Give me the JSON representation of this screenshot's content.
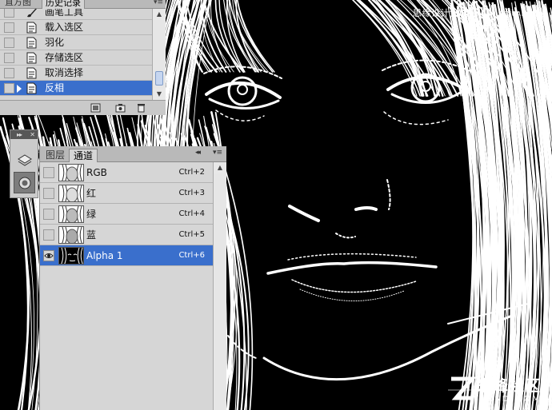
{
  "watermarks": {
    "top_text": "思缘设计论坛",
    "top_url": "www.MISSYUAN.COM",
    "bottom_main": "朱峰社区",
    "bottom_sub": "ZFSD.COM"
  },
  "history_panel": {
    "tabs": [
      {
        "label": "直方图",
        "active": false
      },
      {
        "label": "历史记录",
        "active": true
      }
    ],
    "items": [
      {
        "label": "画笔工具",
        "icon": "brush-icon",
        "selected": false
      },
      {
        "label": "载入选区",
        "icon": "history-state-icon",
        "selected": false
      },
      {
        "label": "羽化",
        "icon": "history-state-icon",
        "selected": false
      },
      {
        "label": "存储选区",
        "icon": "history-state-icon",
        "selected": false
      },
      {
        "label": "取消选择",
        "icon": "history-state-icon",
        "selected": false
      },
      {
        "label": "反相",
        "icon": "history-state-icon",
        "selected": true
      }
    ],
    "bottom_icons": [
      "new-document-from-state-icon",
      "new-snapshot-icon",
      "trash-icon"
    ]
  },
  "toolstrip": {
    "buttons": [
      {
        "icon": "layers-icon",
        "active": false
      },
      {
        "icon": "channels-icon",
        "active": true
      }
    ]
  },
  "channels_panel": {
    "tabs": [
      {
        "label": "图层",
        "active": false
      },
      {
        "label": "通道",
        "active": true
      }
    ],
    "channels": [
      {
        "name": "RGB",
        "shortcut": "Ctrl+2",
        "visible": false,
        "selected": false
      },
      {
        "name": "红",
        "shortcut": "Ctrl+3",
        "visible": false,
        "selected": false
      },
      {
        "name": "绿",
        "shortcut": "Ctrl+4",
        "visible": false,
        "selected": false
      },
      {
        "name": "蓝",
        "shortcut": "Ctrl+5",
        "visible": false,
        "selected": false
      },
      {
        "name": "Alpha 1",
        "shortcut": "Ctrl+6",
        "visible": true,
        "selected": true
      }
    ]
  },
  "colors": {
    "selection": "#3a6fcc",
    "panel_bg": "#d4d4d4",
    "canvas_bg": "#000000",
    "line_art": "#ffffff"
  }
}
